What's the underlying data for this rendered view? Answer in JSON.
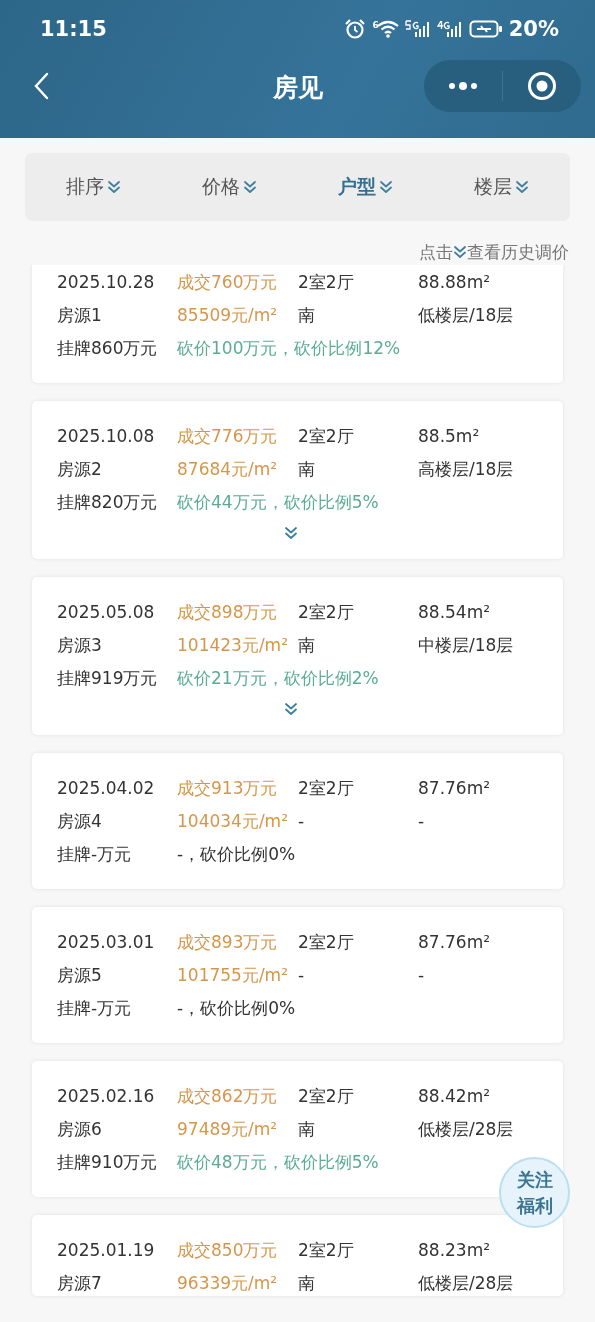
{
  "status_bar": {
    "time": "11:15",
    "wifi_badge": "6",
    "battery": "20%"
  },
  "nav": {
    "title": "房见"
  },
  "filters": [
    {
      "label": "排序",
      "selected": false
    },
    {
      "label": "价格",
      "selected": false
    },
    {
      "label": "户型",
      "selected": true
    },
    {
      "label": "楼层",
      "selected": false
    }
  ],
  "hint": {
    "before": "点击",
    "after": "查看历史调价"
  },
  "listings": [
    {
      "date": "2025.10.28",
      "deal": "成交760万元",
      "layout": "2室2厅",
      "area": "88.88m²",
      "source": "房源1",
      "unit_price": "85509元/m²",
      "facing": "南",
      "floor": "低楼层/18层",
      "listed": "挂牌860万元",
      "cut": "砍价100万元，砍价比例12%",
      "cut_known": true,
      "expandable": false
    },
    {
      "date": "2025.10.08",
      "deal": "成交776万元",
      "layout": "2室2厅",
      "area": "88.5m²",
      "source": "房源2",
      "unit_price": "87684元/m²",
      "facing": "南",
      "floor": "高楼层/18层",
      "listed": "挂牌820万元",
      "cut": "砍价44万元，砍价比例5%",
      "cut_known": true,
      "expandable": true
    },
    {
      "date": "2025.05.08",
      "deal": "成交898万元",
      "layout": "2室2厅",
      "area": "88.54m²",
      "source": "房源3",
      "unit_price": "101423元/m²",
      "facing": "南",
      "floor": "中楼层/18层",
      "listed": "挂牌919万元",
      "cut": "砍价21万元，砍价比例2%",
      "cut_known": true,
      "expandable": true
    },
    {
      "date": "2025.04.02",
      "deal": "成交913万元",
      "layout": "2室2厅",
      "area": "87.76m²",
      "source": "房源4",
      "unit_price": "104034元/m²",
      "facing": "-",
      "floor": "-",
      "listed": "挂牌-万元",
      "cut": "-，砍价比例0%",
      "cut_known": false,
      "expandable": false
    },
    {
      "date": "2025.03.01",
      "deal": "成交893万元",
      "layout": "2室2厅",
      "area": "87.76m²",
      "source": "房源5",
      "unit_price": "101755元/m²",
      "facing": "-",
      "floor": "-",
      "listed": "挂牌-万元",
      "cut": "-，砍价比例0%",
      "cut_known": false,
      "expandable": false
    },
    {
      "date": "2025.02.16",
      "deal": "成交862万元",
      "layout": "2室2厅",
      "area": "88.42m²",
      "source": "房源6",
      "unit_price": "97489元/m²",
      "facing": "南",
      "floor": "低楼层/28层",
      "listed": "挂牌910万元",
      "cut": "砍价48万元，砍价比例5%",
      "cut_known": true,
      "expandable": false
    },
    {
      "date": "2025.01.19",
      "deal": "成交850万元",
      "layout": "2室2厅",
      "area": "88.23m²",
      "source": "房源7",
      "unit_price": "96339元/m²",
      "facing": "南",
      "floor": "低楼层/28层"
    }
  ],
  "float_button": {
    "label": "关注福利"
  }
}
